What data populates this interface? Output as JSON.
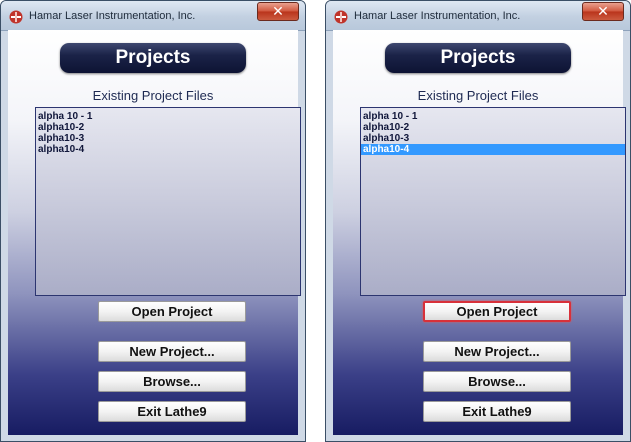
{
  "windows": [
    {
      "title": "Hamar Laser Instrumentation, Inc.",
      "close_label": "✕",
      "heading": "Projects",
      "list_label": "Existing Project Files",
      "files": [
        "alpha 10 - 1",
        "alpha10-2",
        "alpha10-3",
        "alpha10-4"
      ],
      "selected_file": null,
      "buttons": {
        "open": "Open Project",
        "new": "New Project...",
        "browse": "Browse...",
        "exit": "Exit Lathe9"
      },
      "focused_button": null
    },
    {
      "title": "Hamar Laser Instrumentation, Inc.",
      "close_label": "✕",
      "heading": "Projects",
      "list_label": "Existing Project Files",
      "files": [
        "alpha 10 - 1",
        "alpha10-2",
        "alpha10-3",
        "alpha10-4"
      ],
      "selected_file": "alpha10-4",
      "buttons": {
        "open": "Open Project",
        "new": "New Project...",
        "browse": "Browse...",
        "exit": "Exit Lathe9"
      },
      "focused_button": "open"
    }
  ],
  "colors": {
    "selection": "#3399ff",
    "focus_border": "#d8313a",
    "banner": "#1b2348",
    "app_icon": "#c0342b"
  },
  "icons": {
    "app": "hamar-laser-logo-icon",
    "close": "close-icon"
  }
}
